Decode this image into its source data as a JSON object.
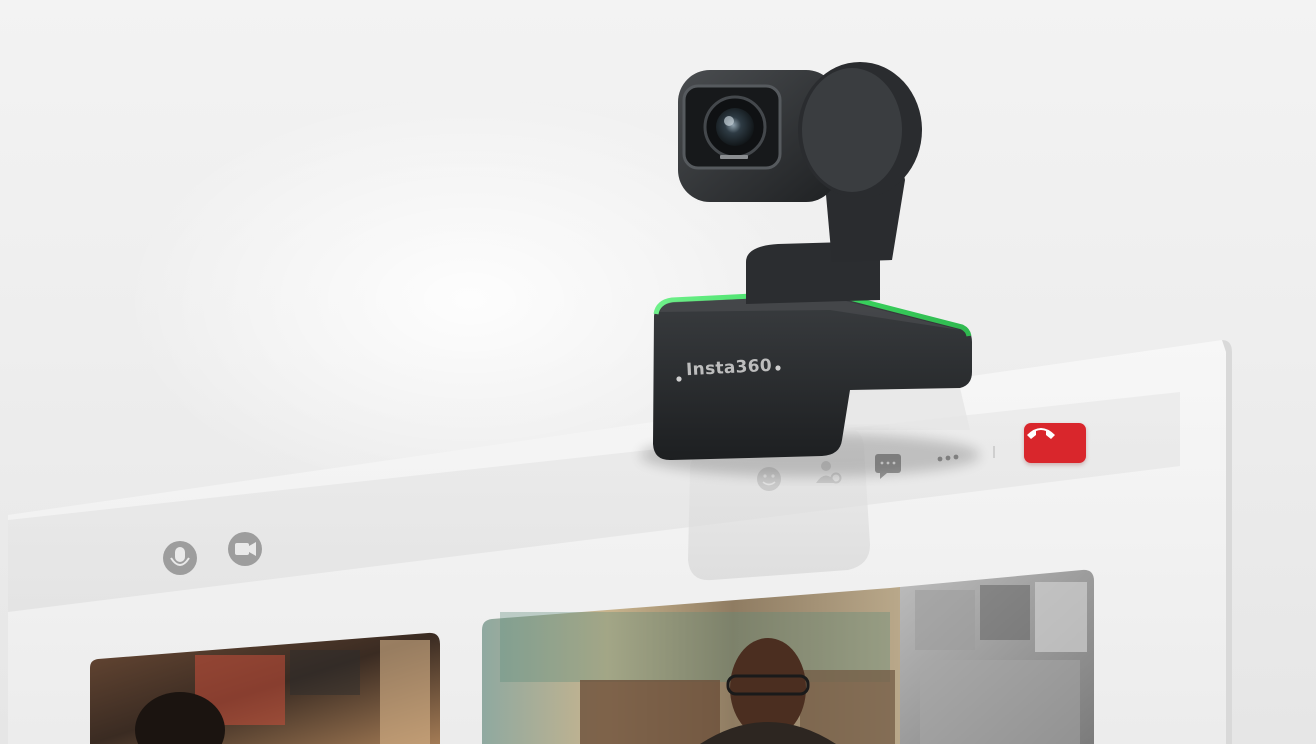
{
  "scene": {
    "description_free": true
  },
  "webcam": {
    "brand_text": "Insta360",
    "status_light_color": "#3ddc62"
  },
  "call_toolbar": {
    "icons": [
      "mic-icon",
      "camera-icon",
      "emoji-icon",
      "participants-icon",
      "chat-icon",
      "more-icon"
    ],
    "hangup_color": "#d9262c",
    "hangup_icon": "phone-hangup-icon"
  },
  "video_tiles": [
    {
      "icon": "participant-video-left"
    },
    {
      "icon": "participant-video-center"
    },
    {
      "icon": "participant-video-right"
    }
  ]
}
